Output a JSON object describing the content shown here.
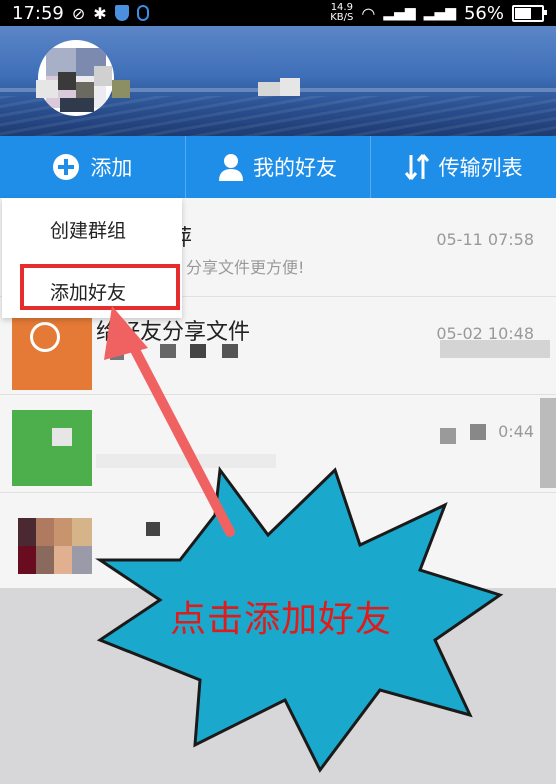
{
  "status_bar": {
    "time": "17:59",
    "net_speed_value": "14.9",
    "net_speed_unit": "KB/S",
    "battery_percent": "56%",
    "battery_level": 0.56
  },
  "tabs": [
    {
      "icon": "plus-circle-icon",
      "label": "添加"
    },
    {
      "icon": "person-icon",
      "label": "我的好友"
    },
    {
      "icon": "transfer-icon",
      "label": "传输列表"
    }
  ],
  "popup_menu": {
    "items": [
      "创建群组",
      "添加好友"
    ]
  },
  "list": {
    "rows": [
      {
        "title_fragment": "萍",
        "subtitle": "分享文件更方便!",
        "time": "05-11 07:58"
      },
      {
        "title": "给好友分享文件",
        "time": "05-02 10:48"
      },
      {
        "time_fragment": "0:44"
      },
      {}
    ]
  },
  "callout": {
    "text": "点击添加好友"
  },
  "colors": {
    "tab_bar": "#1f8ee8",
    "highlight": "#e52d2d",
    "callout_fill": "#1aa9cc",
    "arrow": "#f06262"
  }
}
